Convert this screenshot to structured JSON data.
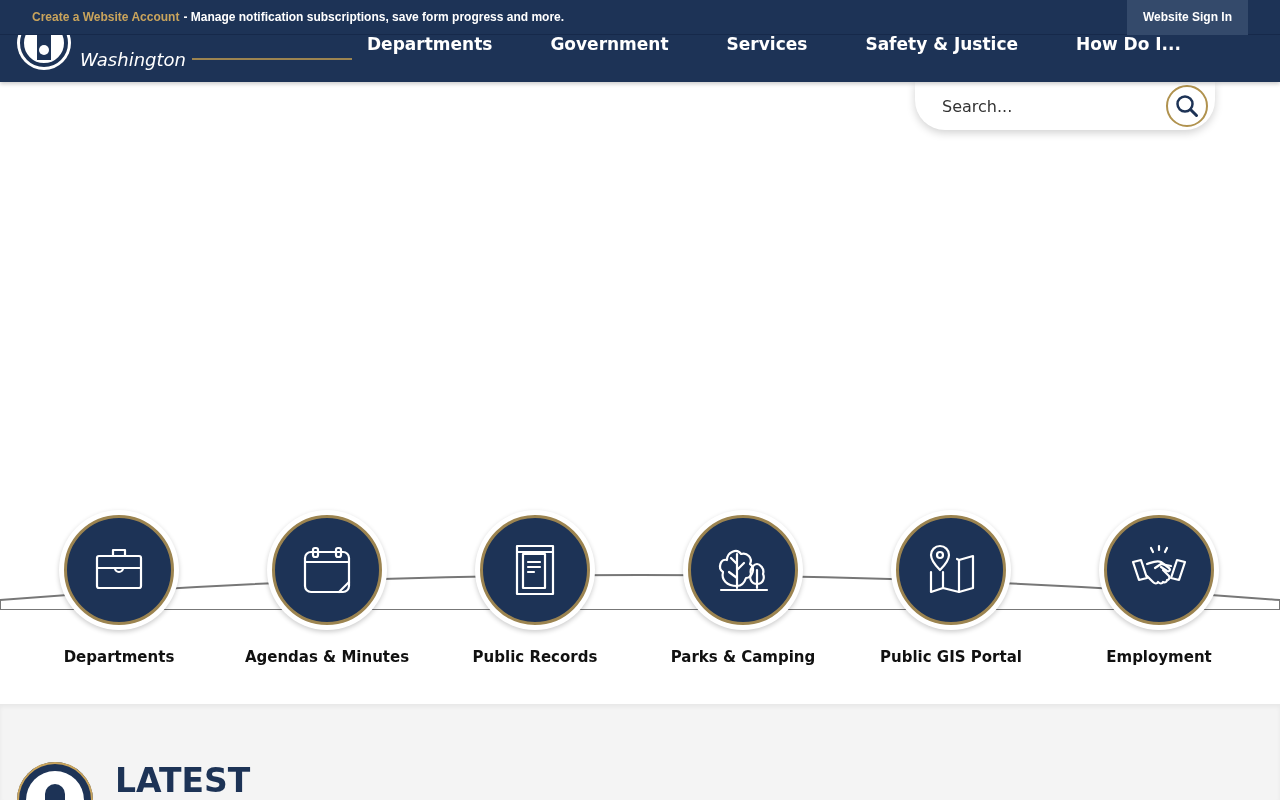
{
  "notification_bar": {
    "link": "Create a Website Account",
    "message": "- Manage notification subscriptions, save form progress and more.",
    "sign_in": "Website Sign In"
  },
  "header": {
    "logo_subtitle": "Washington",
    "nav": [
      "Departments",
      "Government",
      "Services",
      "Safety & Justice",
      "How Do I..."
    ]
  },
  "search": {
    "placeholder": "Search..."
  },
  "quick_links": [
    {
      "label": "Departments",
      "kind": "briefcase"
    },
    {
      "label": "Agendas & Minutes",
      "kind": "calendar"
    },
    {
      "label": "Public Records",
      "kind": "document"
    },
    {
      "label": "Parks & Camping",
      "kind": "trees"
    },
    {
      "label": "Public GIS Portal",
      "kind": "map"
    },
    {
      "label": "Employment",
      "kind": "handshake"
    }
  ],
  "latest": {
    "heading": "LATEST"
  }
}
